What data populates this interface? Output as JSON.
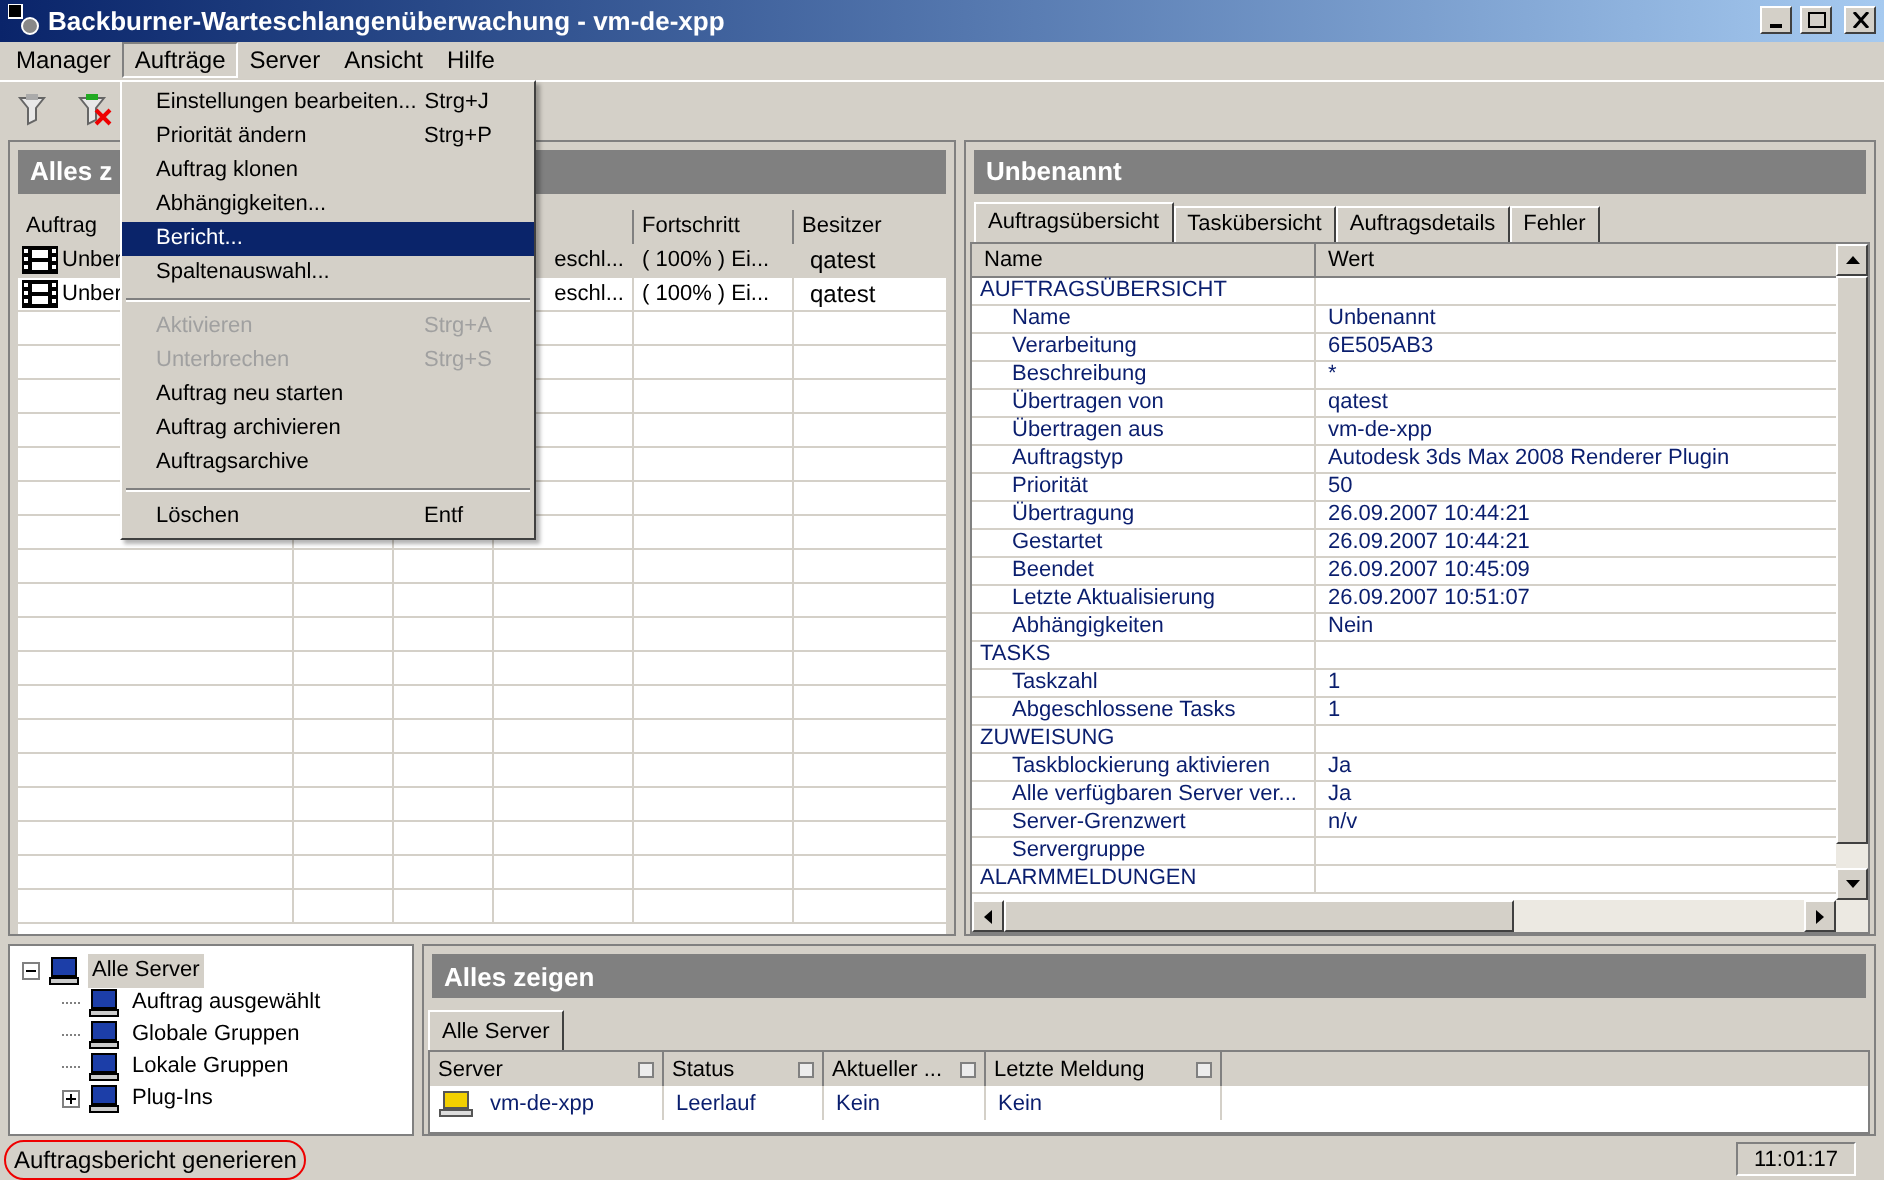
{
  "window": {
    "title": "Backburner-Warteschlangenüberwachung - vm-de-xpp"
  },
  "menubar": [
    {
      "label": "Manager",
      "selected": false
    },
    {
      "label": "Aufträge",
      "selected": true
    },
    {
      "label": "Server",
      "selected": false
    },
    {
      "label": "Ansicht",
      "selected": false
    },
    {
      "label": "Hilfe",
      "selected": false
    }
  ],
  "menu": [
    {
      "kind": "item",
      "label": "Einstellungen bearbeiten...",
      "shortcut": "Strg+J",
      "disabled": false,
      "selected": false
    },
    {
      "kind": "item",
      "label": "Priorität ändern",
      "shortcut": "Strg+P",
      "disabled": false,
      "selected": false
    },
    {
      "kind": "item",
      "label": "Auftrag klonen",
      "disabled": false,
      "selected": false
    },
    {
      "kind": "item",
      "label": "Abhängigkeiten...",
      "disabled": false,
      "selected": false
    },
    {
      "kind": "item",
      "label": "Bericht...",
      "disabled": false,
      "selected": true
    },
    {
      "kind": "item",
      "label": "Spaltenauswahl...",
      "disabled": false,
      "selected": false
    },
    {
      "kind": "separator"
    },
    {
      "kind": "item",
      "label": "Aktivieren",
      "shortcut": "Strg+A",
      "disabled": true,
      "selected": false
    },
    {
      "kind": "item",
      "label": "Unterbrechen",
      "shortcut": "Strg+S",
      "disabled": true,
      "selected": false
    },
    {
      "kind": "item",
      "label": "Auftrag neu starten",
      "disabled": false,
      "selected": false
    },
    {
      "kind": "item",
      "label": "Auftrag archivieren",
      "disabled": false,
      "selected": false
    },
    {
      "kind": "item",
      "label": "Auftragsarchive",
      "disabled": false,
      "selected": false
    },
    {
      "kind": "separator"
    },
    {
      "kind": "item",
      "label": "Löschen",
      "shortcut": "Entf",
      "disabled": false,
      "selected": false
    }
  ],
  "jobs_panel": {
    "title": "Alles z",
    "columns": [
      "Auftrag",
      "Fortschritt",
      "Besitzer"
    ],
    "rows": [
      {
        "name": "Unber",
        "column_4": "eschl...",
        "progress": "( 100% ) Ei...",
        "owner": "qatest",
        "selected": true
      },
      {
        "name": "Unber",
        "column_4": "eschl...",
        "progress": "( 100% ) Ei...",
        "owner": "qatest",
        "selected": false
      }
    ]
  },
  "details_panel": {
    "title": "Unbenannt",
    "tabs": [
      {
        "label": "Auftragsübersicht",
        "selected": true
      },
      {
        "label": "Taskübersicht",
        "selected": false
      },
      {
        "label": "Auftragsdetails",
        "selected": false
      },
      {
        "label": "Fehler",
        "selected": false
      }
    ],
    "columns": [
      "Name",
      "Wert"
    ],
    "rows": [
      {
        "kind": "section",
        "name": "AUFTRAGSÜBERSICHT"
      },
      {
        "kind": "property",
        "name": "Name",
        "value": "Unbenannt"
      },
      {
        "kind": "property",
        "name": "Verarbeitung",
        "value": "6E505AB3"
      },
      {
        "kind": "property",
        "name": "Beschreibung",
        "value": "*"
      },
      {
        "kind": "property",
        "name": "Übertragen von",
        "value": "qatest"
      },
      {
        "kind": "property",
        "name": "Übertragen aus",
        "value": "vm-de-xpp"
      },
      {
        "kind": "property",
        "name": "Auftragstyp",
        "value": "Autodesk 3ds Max 2008 Renderer Plugin"
      },
      {
        "kind": "property",
        "name": "Priorität",
        "value": "50"
      },
      {
        "kind": "property",
        "name": "Übertragung",
        "value": "26.09.2007 10:44:21"
      },
      {
        "kind": "property",
        "name": "Gestartet",
        "value": "26.09.2007 10:44:21"
      },
      {
        "kind": "property",
        "name": "Beendet",
        "value": "26.09.2007 10:45:09"
      },
      {
        "kind": "property",
        "name": "Letzte Aktualisierung",
        "value": "26.09.2007 10:51:07"
      },
      {
        "kind": "property",
        "name": "Abhängigkeiten",
        "value": "Nein"
      },
      {
        "kind": "section",
        "name": "TASKS"
      },
      {
        "kind": "property",
        "name": "Taskzahl",
        "value": "1"
      },
      {
        "kind": "property",
        "name": "Abgeschlossene Tasks",
        "value": "1"
      },
      {
        "kind": "section",
        "name": "ZUWEISUNG"
      },
      {
        "kind": "property",
        "name": "Taskblockierung aktivieren",
        "value": "Ja"
      },
      {
        "kind": "property",
        "name": "Alle verfügbaren Server ver...",
        "value": "Ja"
      },
      {
        "kind": "property",
        "name": "Server-Grenzwert",
        "value": "n/v"
      },
      {
        "kind": "property",
        "name": "Servergruppe"
      },
      {
        "kind": "section",
        "name": "ALARMMELDUNGEN"
      }
    ]
  },
  "server_tree": [
    {
      "label": "Alle Server",
      "expanded": true,
      "selected": true,
      "children": [
        {
          "label": "Auftrag ausgewählt",
          "selected": false
        },
        {
          "label": "Globale Gruppen",
          "selected": false
        },
        {
          "label": "Lokale Gruppen",
          "selected": false
        },
        {
          "label": "Plug-Ins",
          "expanded": false,
          "selected": false
        }
      ]
    }
  ],
  "servers_panel": {
    "title": "Alles zeigen",
    "tabs": [
      {
        "label": "Alle Server",
        "selected": true
      }
    ],
    "columns": [
      "Server",
      "Status",
      "Aktueller ...",
      "Letzte Meldung"
    ],
    "rows": [
      {
        "server": "vm-de-xpp",
        "status": "Leerlauf",
        "current": "Kein",
        "last_message": "Kein"
      }
    ]
  },
  "status_bar": {
    "message": "Auftragsbericht generieren",
    "time": "11:01:17"
  }
}
